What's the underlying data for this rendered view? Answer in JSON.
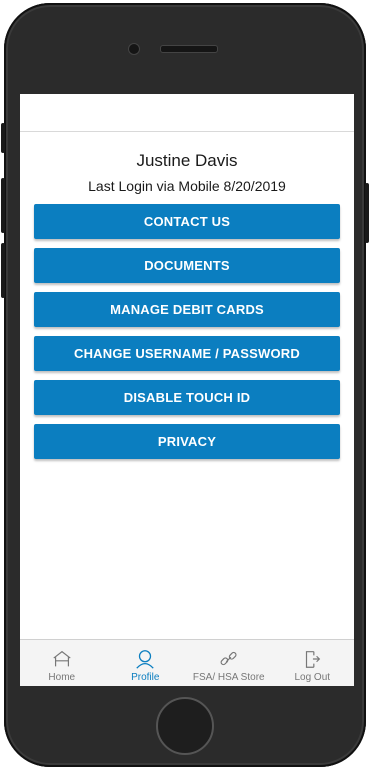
{
  "profile": {
    "name": "Justine Davis",
    "last_login": "Last Login via Mobile 8/20/2019"
  },
  "actions": [
    {
      "label": "CONTACT US"
    },
    {
      "label": "DOCUMENTS"
    },
    {
      "label": "MANAGE DEBIT CARDS"
    },
    {
      "label": "CHANGE USERNAME / PASSWORD"
    },
    {
      "label": "DISABLE TOUCH ID"
    },
    {
      "label": "PRIVACY"
    }
  ],
  "tabs": [
    {
      "label": "Home",
      "icon": "home-icon"
    },
    {
      "label": "Profile",
      "icon": "profile-icon",
      "active": true
    },
    {
      "label": "FSA/ HSA Store",
      "icon": "link-icon"
    },
    {
      "label": "Log Out",
      "icon": "logout-icon"
    }
  ],
  "colors": {
    "accent": "#0b7ec0",
    "tab_inactive": "#777777",
    "device_body": "#2b2b2b"
  }
}
